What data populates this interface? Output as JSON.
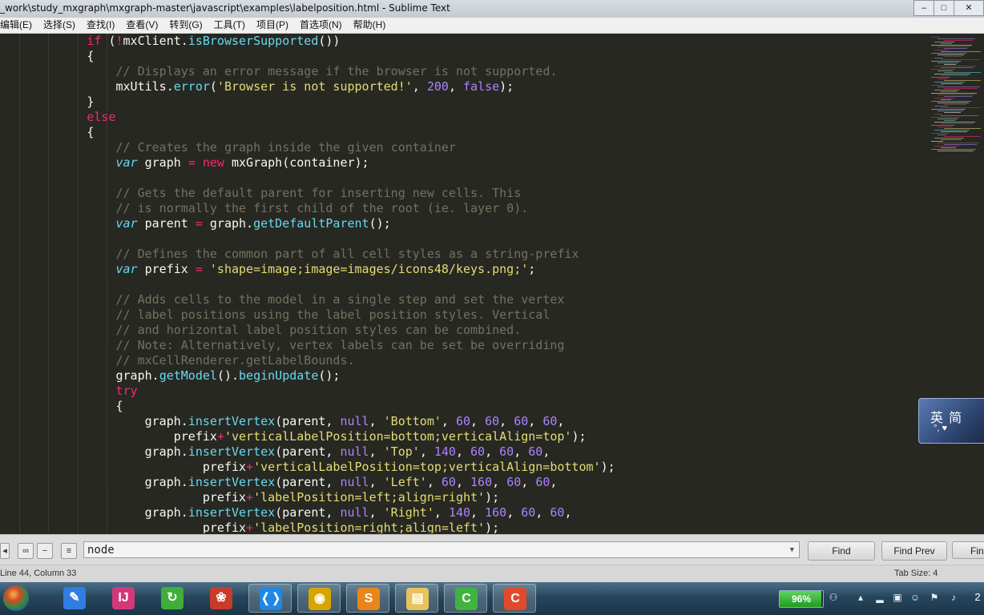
{
  "window": {
    "title": "_work\\study_mxgraph\\mxgraph-master\\javascript\\examples\\labelposition.html - Sublime Text",
    "controls": [
      "–",
      "□",
      "✕"
    ]
  },
  "menu": [
    "编辑(E)",
    "选择(S)",
    "查找(I)",
    "查看(V)",
    "转到(G)",
    "工具(T)",
    "项目(P)",
    "首选项(N)",
    "帮助(H)"
  ],
  "code_lines": [
    [
      [
        "            ",
        "pl"
      ],
      [
        "if",
        "kw"
      ],
      [
        " (",
        "pl"
      ],
      [
        "!",
        "op"
      ],
      [
        "mxClient.",
        "pl"
      ],
      [
        "isBrowserSupported",
        "fn"
      ],
      [
        "())",
        "pl"
      ]
    ],
    [
      [
        "            {",
        "pl"
      ]
    ],
    [
      [
        "                ",
        "pl"
      ],
      [
        "// Displays an error message if the browser is not supported.",
        "com"
      ]
    ],
    [
      [
        "                mxUtils.",
        "pl"
      ],
      [
        "error",
        "fn"
      ],
      [
        "(",
        "pl"
      ],
      [
        "'Browser is not supported!'",
        "str"
      ],
      [
        ", ",
        "pl"
      ],
      [
        "200",
        "num"
      ],
      [
        ", ",
        "pl"
      ],
      [
        "false",
        "num"
      ],
      [
        ");",
        "pl"
      ]
    ],
    [
      [
        "            }",
        "pl"
      ]
    ],
    [
      [
        "            ",
        "pl"
      ],
      [
        "else",
        "kw"
      ]
    ],
    [
      [
        "            ",
        "pl"
      ],
      [
        "{",
        "u"
      ]
    ],
    [
      [
        "                ",
        "pl"
      ],
      [
        "// Creates the graph inside the given container",
        "com"
      ]
    ],
    [
      [
        "                ",
        "pl"
      ],
      [
        "var",
        "it"
      ],
      [
        " graph ",
        "pl"
      ],
      [
        "=",
        "op"
      ],
      [
        " ",
        "pl"
      ],
      [
        "new",
        "kw"
      ],
      [
        " mxGraph(container);",
        "pl"
      ]
    ],
    [
      [
        "",
        "pl"
      ]
    ],
    [
      [
        "                ",
        "pl"
      ],
      [
        "// Gets the default parent for inserting new cells. This",
        "com"
      ]
    ],
    [
      [
        "                ",
        "pl"
      ],
      [
        "// is normally the first child of the root (ie. layer 0).",
        "com"
      ]
    ],
    [
      [
        "                ",
        "pl"
      ],
      [
        "var",
        "it"
      ],
      [
        " parent ",
        "pl"
      ],
      [
        "=",
        "op"
      ],
      [
        " graph.",
        "pl"
      ],
      [
        "getDefaultParent",
        "fn"
      ],
      [
        "();",
        "pl"
      ]
    ],
    [
      [
        "",
        "pl"
      ]
    ],
    [
      [
        "                ",
        "pl"
      ],
      [
        "// Defines the common part of all cell styles as a string-prefix",
        "com"
      ]
    ],
    [
      [
        "                ",
        "pl"
      ],
      [
        "var",
        "it"
      ],
      [
        " prefix ",
        "pl"
      ],
      [
        "=",
        "op"
      ],
      [
        " ",
        "pl"
      ],
      [
        "'shape=image;image=images/icons48/keys.png;'",
        "str"
      ],
      [
        ";",
        "pl"
      ]
    ],
    [
      [
        "",
        "pl"
      ]
    ],
    [
      [
        "                ",
        "pl"
      ],
      [
        "// Adds cells to the model in a single step and set the vertex",
        "com"
      ]
    ],
    [
      [
        "                ",
        "pl"
      ],
      [
        "// label positions using the label position styles. Vertical",
        "com"
      ]
    ],
    [
      [
        "                ",
        "pl"
      ],
      [
        "// and horizontal label position styles can be combined.",
        "com"
      ]
    ],
    [
      [
        "                ",
        "pl"
      ],
      [
        "// Note: Alternatively, vertex labels can be set be overriding",
        "com"
      ]
    ],
    [
      [
        "                ",
        "pl"
      ],
      [
        "// mxCellRenderer.getLabelBounds.",
        "com"
      ]
    ],
    [
      [
        "                graph.",
        "pl"
      ],
      [
        "getModel",
        "fn"
      ],
      [
        "().",
        "pl"
      ],
      [
        "beginUpdate",
        "fn"
      ],
      [
        "();",
        "pl"
      ]
    ],
    [
      [
        "                ",
        "pl"
      ],
      [
        "try",
        "kw"
      ]
    ],
    [
      [
        "                {",
        "pl"
      ]
    ],
    [
      [
        "                    graph.",
        "pl"
      ],
      [
        "insertVertex",
        "fn"
      ],
      [
        "(parent, ",
        "pl"
      ],
      [
        "null",
        "num"
      ],
      [
        ", ",
        "pl"
      ],
      [
        "'Bottom'",
        "str"
      ],
      [
        ", ",
        "pl"
      ],
      [
        "60",
        "num"
      ],
      [
        ", ",
        "pl"
      ],
      [
        "60",
        "num"
      ],
      [
        ", ",
        "pl"
      ],
      [
        "60",
        "num"
      ],
      [
        ", ",
        "pl"
      ],
      [
        "60",
        "num"
      ],
      [
        ",",
        "pl"
      ]
    ],
    [
      [
        "                        prefix",
        "pl"
      ],
      [
        "+",
        "op"
      ],
      [
        "'verticalLabelPosition=bottom;verticalAlign=top'",
        "str"
      ],
      [
        ");",
        "pl"
      ]
    ],
    [
      [
        "                    graph.",
        "pl"
      ],
      [
        "insertVertex",
        "fn"
      ],
      [
        "(parent, ",
        "pl"
      ],
      [
        "null",
        "num"
      ],
      [
        ", ",
        "pl"
      ],
      [
        "'Top'",
        "str"
      ],
      [
        ", ",
        "pl"
      ],
      [
        "140",
        "num"
      ],
      [
        ", ",
        "pl"
      ],
      [
        "60",
        "num"
      ],
      [
        ", ",
        "pl"
      ],
      [
        "60",
        "num"
      ],
      [
        ", ",
        "pl"
      ],
      [
        "60",
        "num"
      ],
      [
        ",",
        "pl"
      ]
    ],
    [
      [
        "                            prefix",
        "pl"
      ],
      [
        "+",
        "op"
      ],
      [
        "'verticalLabelPosition=top;verticalAlign=bottom'",
        "str"
      ],
      [
        ");",
        "pl"
      ]
    ],
    [
      [
        "                    graph.",
        "pl"
      ],
      [
        "insertVertex",
        "fn"
      ],
      [
        "(parent, ",
        "pl"
      ],
      [
        "null",
        "num"
      ],
      [
        ", ",
        "pl"
      ],
      [
        "'Left'",
        "str"
      ],
      [
        ", ",
        "pl"
      ],
      [
        "60",
        "num"
      ],
      [
        ", ",
        "pl"
      ],
      [
        "160",
        "num"
      ],
      [
        ", ",
        "pl"
      ],
      [
        "60",
        "num"
      ],
      [
        ", ",
        "pl"
      ],
      [
        "60",
        "num"
      ],
      [
        ",",
        "pl"
      ]
    ],
    [
      [
        "                            prefix",
        "pl"
      ],
      [
        "+",
        "op"
      ],
      [
        "'labelPosition=left;align=right'",
        "str"
      ],
      [
        ");",
        "pl"
      ]
    ],
    [
      [
        "                    graph.",
        "pl"
      ],
      [
        "insertVertex",
        "fn"
      ],
      [
        "(parent, ",
        "pl"
      ],
      [
        "null",
        "num"
      ],
      [
        ", ",
        "pl"
      ],
      [
        "'Right'",
        "str"
      ],
      [
        ", ",
        "pl"
      ],
      [
        "140",
        "num"
      ],
      [
        ", ",
        "pl"
      ],
      [
        "160",
        "num"
      ],
      [
        ", ",
        "pl"
      ],
      [
        "60",
        "num"
      ],
      [
        ", ",
        "pl"
      ],
      [
        "60",
        "num"
      ],
      [
        ",",
        "pl"
      ]
    ],
    [
      [
        "                            prefix",
        "pl"
      ],
      [
        "+",
        "op"
      ],
      [
        "'labelPosition=right;align=left'",
        "str"
      ],
      [
        ");",
        "pl"
      ]
    ]
  ],
  "ime": {
    "label": "英 简",
    "sub": "°, ♥"
  },
  "findbar": {
    "query": "node",
    "find": "Find",
    "find_prev": "Find Prev",
    "find_all": "Fin"
  },
  "status": {
    "position": "Line 44, Column 33",
    "tab_size": "Tab Size: 4"
  },
  "taskbar": {
    "apps": [
      {
        "name": "pen-app-icon",
        "glyph": "✎",
        "color": "#2f7de1"
      },
      {
        "name": "intellij-icon",
        "glyph": "IJ",
        "color": "#d4387a"
      },
      {
        "name": "browser-360-icon",
        "glyph": "↻",
        "color": "#3fae3a"
      },
      {
        "name": "fiddler-icon",
        "glyph": "❀",
        "color": "#c83a2a"
      },
      {
        "name": "vscode-icon",
        "glyph": "❬❭",
        "color": "#1f88e5"
      },
      {
        "name": "chrome-icon",
        "glyph": "◉",
        "color": "#d8a400"
      },
      {
        "name": "sublime-icon",
        "glyph": "S",
        "color": "#e8861c"
      },
      {
        "name": "explorer-icon",
        "glyph": "▤",
        "color": "#e8c25a"
      },
      {
        "name": "camtasia-icon",
        "glyph": "C",
        "color": "#3fb43f"
      },
      {
        "name": "recorder-icon",
        "glyph": "C",
        "color": "#e24a2e"
      }
    ],
    "battery_percent": 96,
    "battery_label": "96%",
    "clock_fragment": "2"
  }
}
